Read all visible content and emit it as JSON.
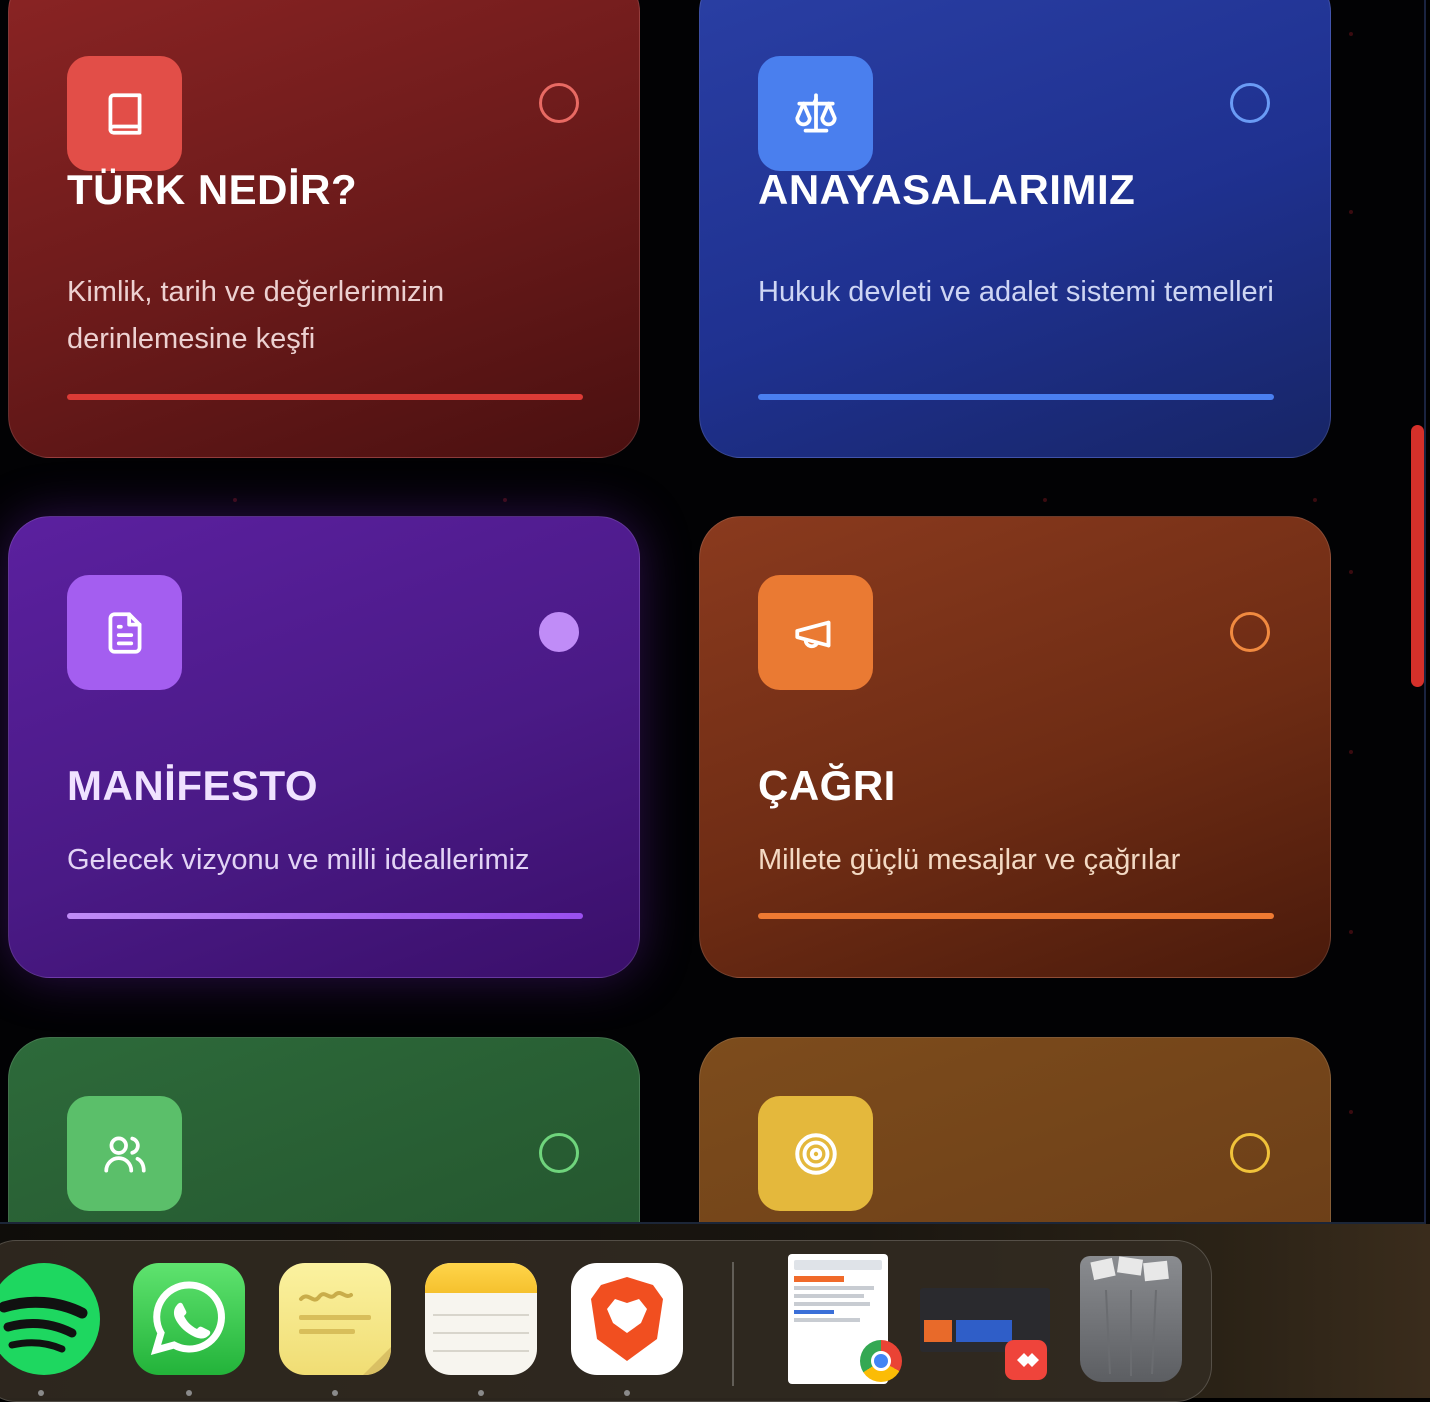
{
  "cards": [
    {
      "title": "TÜRK NEDİR?",
      "description": "Kimlik, tarih ve değerlerimizin derinlemesine keşfi",
      "icon": "book-icon",
      "accent": "#e44a45",
      "selected": false
    },
    {
      "title": "ANAYASALARIMIZ",
      "description": "Hukuk devleti ve adalet sistemi temelleri",
      "icon": "scale-icon",
      "accent": "#4a7ff0",
      "selected": false
    },
    {
      "title": "MANİFESTO",
      "description": "Gelecek vizyonu ve milli ideallerimiz",
      "icon": "document-icon",
      "accent": "#a45ef0",
      "selected": true
    },
    {
      "title": "ÇAĞRI",
      "description": "Millete güçlü mesajlar ve çağrılar",
      "icon": "megaphone-icon",
      "accent": "#ef7a32",
      "selected": false
    },
    {
      "title": "",
      "description": "",
      "icon": "users-icon",
      "accent": "#5bc46a",
      "selected": false
    },
    {
      "title": "",
      "description": "",
      "icon": "target-icon",
      "accent": "#e8b83a",
      "selected": false
    }
  ],
  "scrollbar": {
    "color": "#d5302a",
    "position": 0.35
  },
  "dock": {
    "apps": [
      "spotify-icon",
      "whatsapp-icon",
      "stickies-icon",
      "notes-icon",
      "brave-icon"
    ],
    "recent": [
      "chrome-window-icon",
      "anydesk-window-icon"
    ],
    "trash": "trash-icon"
  }
}
